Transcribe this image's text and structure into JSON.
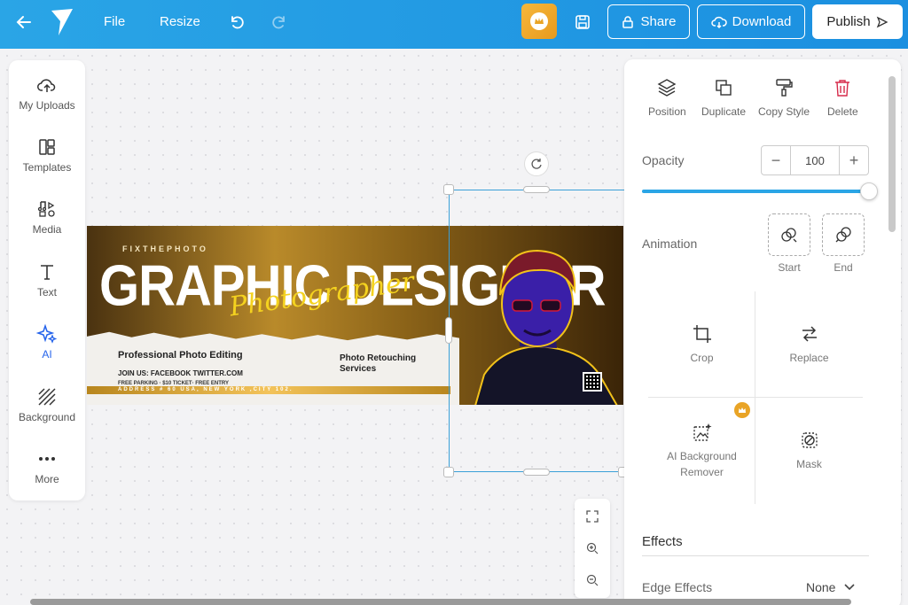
{
  "topbar": {
    "file": "File",
    "resize": "Resize",
    "share": "Share",
    "download": "Download",
    "publish": "Publish"
  },
  "left_tools": [
    {
      "label": "My Uploads",
      "icon": "cloud-upload-icon"
    },
    {
      "label": "Templates",
      "icon": "templates-icon"
    },
    {
      "label": "Media",
      "icon": "media-icon"
    },
    {
      "label": "Text",
      "icon": "text-icon"
    },
    {
      "label": "AI",
      "icon": "sparkle-icon"
    },
    {
      "label": "Background",
      "icon": "background-icon"
    },
    {
      "label": "More",
      "icon": "more-icon"
    }
  ],
  "banner": {
    "kicker": "FIXTHEPHOTO",
    "headline": "GRAPHIC DESIGNER",
    "script": "Photographer",
    "line1": "Professional Photo Editing",
    "line2": "JOIN US:  FACEBOOK    TWITTER.COM",
    "line3": "FREE PARKING · $10 TICKET· FREE ENTRY",
    "line4": "Photo Retouching Services",
    "address": "ADDRESS # 60 USA, NEW YORK ,CITY 102."
  },
  "panel": {
    "actions": [
      "Position",
      "Duplicate",
      "Copy Style",
      "Delete"
    ],
    "opacity_label": "Opacity",
    "opacity_value": "100",
    "opacity_fraction": 1.0,
    "animation_label": "Animation",
    "anim_start": "Start",
    "anim_end": "End",
    "crop": "Crop",
    "replace": "Replace",
    "ai_bg_remover": "AI Background Remover",
    "mask": "Mask",
    "effects": "Effects",
    "edge_effects": "Edge Effects",
    "edge_value": "None"
  },
  "colors": {
    "accent": "#2aa5e6",
    "active": "#2463eb",
    "premium": "#e9a426"
  }
}
